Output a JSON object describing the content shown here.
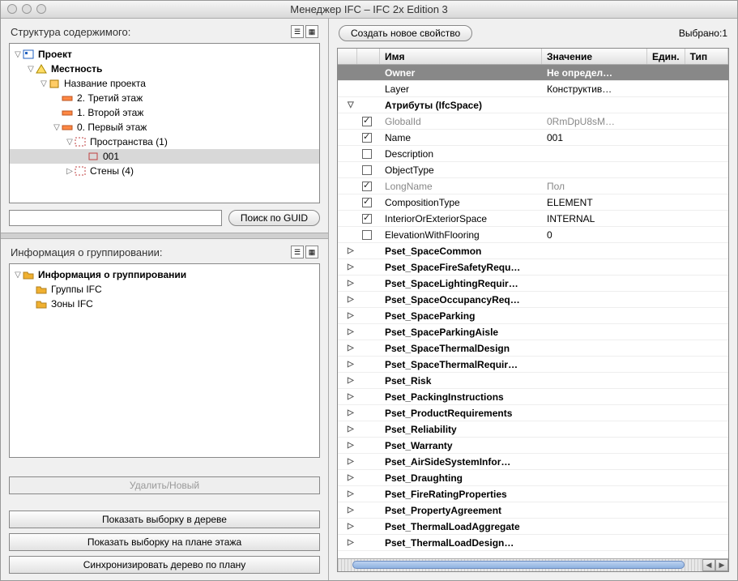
{
  "window": {
    "title": "Менеджер IFC – IFC 2x Edition 3"
  },
  "left": {
    "structure_title": "Структура содержимого:",
    "tree": {
      "project": "Проект",
      "site": "Местность",
      "building": "Название проекта",
      "story2": "2. Третий этаж",
      "story1": "1. Второй этаж",
      "story0": "0. Первый этаж",
      "spaces": "Пространства (1)",
      "space001": "001",
      "walls": "Стены (4)"
    },
    "search_btn": "Поиск по GUID",
    "group_title": "Информация о группировании:",
    "group_tree": {
      "root": "Информация о группировании",
      "ifc_groups": "Группы IFC",
      "ifc_zones": "Зоны IFC"
    },
    "btn_delete": "Удалить/Новый",
    "btn_show_tree": "Показать выборку в дереве",
    "btn_show_plan": "Показать выборку на плане этажа",
    "btn_sync": "Синхронизировать дерево по плану"
  },
  "right": {
    "create_btn": "Создать новое свойство",
    "selected": "Выбрано:1",
    "cols": {
      "name": "Имя",
      "value": "Значение",
      "unit": "Един.",
      "type": "Тип"
    },
    "rows": [
      {
        "kind": "dark",
        "name": "Owner",
        "value": "Не определ…"
      },
      {
        "kind": "gray",
        "name": "Layer",
        "value": "Конструктив…"
      },
      {
        "kind": "header",
        "expander": "▽",
        "name": "Атрибуты (IfcSpace)"
      },
      {
        "kind": "attr",
        "checked": true,
        "gray": true,
        "name": "GlobalId",
        "value": "0RmDpU8sM…"
      },
      {
        "kind": "attr",
        "checked": true,
        "name": "Name",
        "value": "001"
      },
      {
        "kind": "attr",
        "checked": false,
        "name": "Description",
        "value": ""
      },
      {
        "kind": "attr",
        "checked": false,
        "name": "ObjectType",
        "value": ""
      },
      {
        "kind": "attr",
        "checked": true,
        "gray": true,
        "name": "LongName",
        "value": "Пол"
      },
      {
        "kind": "attr",
        "checked": true,
        "name": "CompositionType",
        "value": "ELEMENT"
      },
      {
        "kind": "attr",
        "checked": true,
        "name": "InteriorOrExteriorSpace",
        "value": "INTERNAL"
      },
      {
        "kind": "attr",
        "checked": false,
        "name": "ElevationWithFlooring",
        "value": "0"
      },
      {
        "kind": "pset",
        "name": "Pset_SpaceCommon"
      },
      {
        "kind": "pset",
        "name": "Pset_SpaceFireSafetyRequ…"
      },
      {
        "kind": "pset",
        "name": "Pset_SpaceLightingRequir…"
      },
      {
        "kind": "pset",
        "name": "Pset_SpaceOccupancyReq…"
      },
      {
        "kind": "pset",
        "name": "Pset_SpaceParking"
      },
      {
        "kind": "pset",
        "name": "Pset_SpaceParkingAisle"
      },
      {
        "kind": "pset",
        "name": "Pset_SpaceThermalDesign"
      },
      {
        "kind": "pset",
        "name": "Pset_SpaceThermalRequir…"
      },
      {
        "kind": "pset",
        "name": "Pset_Risk"
      },
      {
        "kind": "pset",
        "name": "Pset_PackingInstructions"
      },
      {
        "kind": "pset",
        "name": "Pset_ProductRequirements"
      },
      {
        "kind": "pset",
        "name": "Pset_Reliability"
      },
      {
        "kind": "pset",
        "name": "Pset_Warranty"
      },
      {
        "kind": "pset",
        "name": "Pset_AirSideSystemInfor…"
      },
      {
        "kind": "pset",
        "name": "Pset_Draughting"
      },
      {
        "kind": "pset",
        "name": "Pset_FireRatingProperties"
      },
      {
        "kind": "pset",
        "name": "Pset_PropertyAgreement"
      },
      {
        "kind": "pset",
        "name": "Pset_ThermalLoadAggregate"
      },
      {
        "kind": "pset",
        "name": "Pset_ThermalLoadDesign…"
      }
    ]
  }
}
